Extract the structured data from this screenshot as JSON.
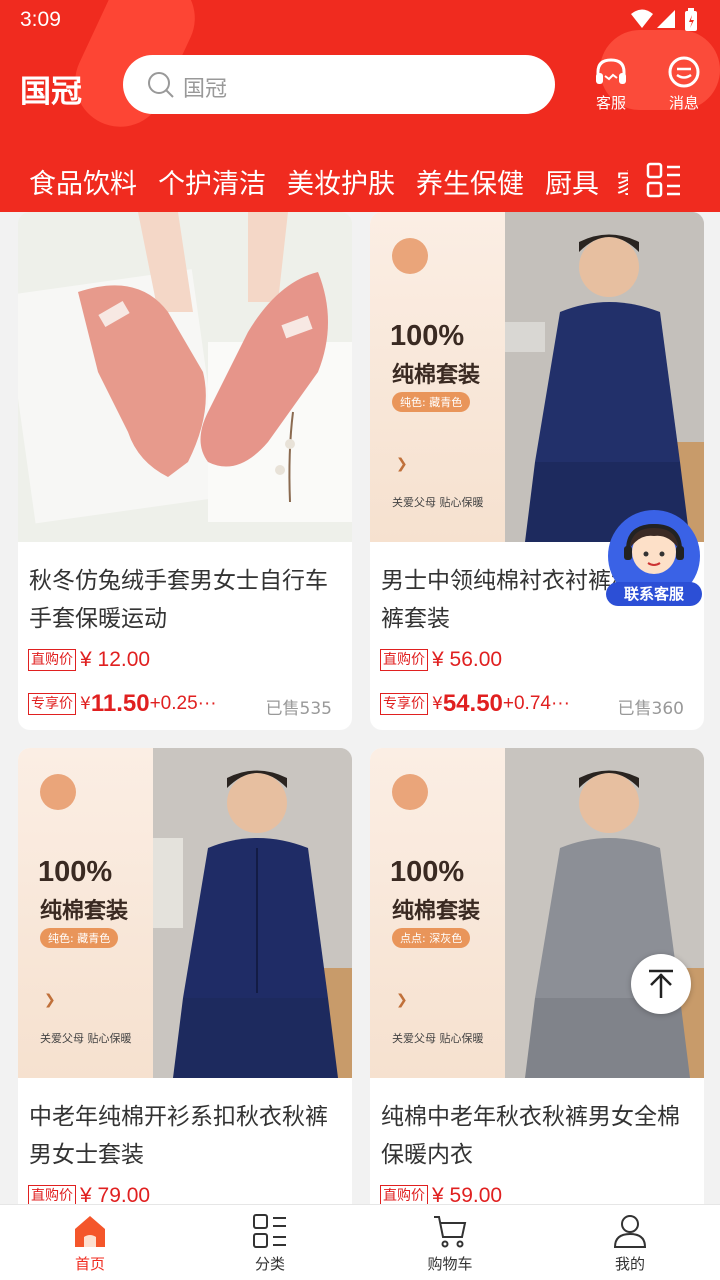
{
  "status": {
    "time": "3:09"
  },
  "header": {
    "brand": "国冠",
    "search_placeholder": "国冠",
    "service_label": "客服",
    "message_label": "消息"
  },
  "categories": [
    "食品饮料",
    "个护清洁",
    "美妆护肤",
    "养生保健",
    "厨具",
    "家"
  ],
  "products": [
    {
      "title": "秋冬仿兔绒手套男女士自行车手套保暖运动",
      "direct_tag": "直购价",
      "direct_price": "¥ 12.00",
      "vip_tag": "专享价",
      "vip_yen": "¥",
      "vip_price": "11.50",
      "vip_extra": "+0.25···",
      "sold": "已售535"
    },
    {
      "title": "男士中领纯棉衬衣衬裤秋衣秋裤套装",
      "direct_tag": "直购价",
      "direct_price": "¥ 56.00",
      "vip_tag": "专享价",
      "vip_yen": "¥",
      "vip_price": "54.50",
      "vip_extra": "+0.74···",
      "sold": "已售360",
      "promo": {
        "pct": "100%",
        "title": "纯棉套装",
        "chip": "纯色: 藏青色",
        "foot": "关爱父母 贴心保暖"
      }
    },
    {
      "title": "中老年纯棉开衫系扣秋衣秋裤男女士套装",
      "direct_tag": "直购价",
      "direct_price": "¥ 79.00",
      "promo": {
        "pct": "100%",
        "title": "纯棉套装",
        "chip": "纯色: 藏青色",
        "foot": "关爱父母 贴心保暖"
      }
    },
    {
      "title": "纯棉中老年秋衣秋裤男女全棉保暖内衣",
      "direct_tag": "直购价",
      "direct_price": "¥ 59.00",
      "promo": {
        "pct": "100%",
        "title": "纯棉套装",
        "chip": "点点: 深灰色",
        "foot": "关爱父母 贴心保暖"
      }
    }
  ],
  "float": {
    "customer_service": "联系客服"
  },
  "nav": {
    "home": "首页",
    "category": "分类",
    "cart": "购物车",
    "mine": "我的"
  },
  "colors": {
    "brand_red": "#f02b1f",
    "price_red": "#e02020",
    "cs_blue": "#2c4fd6"
  }
}
